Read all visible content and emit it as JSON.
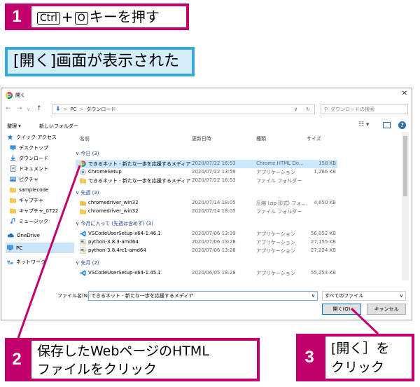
{
  "step1": {
    "num": "1",
    "key_ctrl": "Ctrl",
    "plus": "+",
    "key_o": "O",
    "text": "キーを押す"
  },
  "banner": "[開く]画面が表示された",
  "dialog": {
    "title": "開く",
    "path_root": "PC",
    "path_sep": ">",
    "path_current": "ダウンロード",
    "search_placeholder": "ダウンロードの検索",
    "toolbar": {
      "organize": "整理 ▾",
      "new_folder": "新しいフォルダー"
    },
    "nav": [
      {
        "label": "クイック アクセス",
        "icon": "star-icon"
      },
      {
        "label": "デスクトップ",
        "icon": "desktop-icon"
      },
      {
        "label": "ダウンロード",
        "icon": "download-icon"
      },
      {
        "label": "ドキュメント",
        "icon": "document-icon"
      },
      {
        "label": "ピクチャ",
        "icon": "picture-icon"
      },
      {
        "label": "samplecode",
        "icon": "folder-icon"
      },
      {
        "label": "キャプチャ",
        "icon": "folder-icon"
      },
      {
        "label": "キャプチャ_0722",
        "icon": "folder-icon"
      },
      {
        "label": "ミュージック",
        "icon": "music-icon"
      },
      {
        "label": "OneDrive",
        "icon": "cloud-icon"
      },
      {
        "label": "PC",
        "icon": "pc-icon"
      },
      {
        "label": "ネットワーク",
        "icon": "network-icon"
      }
    ],
    "columns": {
      "name": "名前",
      "date": "更新日時",
      "type": "種類",
      "size": "サイズ"
    },
    "groups": [
      {
        "label": "今日 (3)",
        "files": [
          {
            "name": "できるネット - 新たな一歩を応援するメディア",
            "date": "2020/07/22 16:53",
            "type": "Chrome HTML Do...",
            "size": "158 KB",
            "icon": "chrome-html-icon",
            "selected": true
          },
          {
            "name": "ChromeSetup",
            "date": "2020/07/22 13:59",
            "type": "アプリケーション",
            "size": "1,266 KB",
            "icon": "setup-icon"
          },
          {
            "name": "できるネット - 新たな一歩を応援するメディア_fil...",
            "date": "2020/07/22 16:53",
            "type": "ファイル フォルダー",
            "size": "",
            "icon": "folder-icon"
          }
        ]
      },
      {
        "label": "先週 (2)",
        "files": [
          {
            "name": "chromedriver_win32",
            "date": "2020/07/14 18:05",
            "type": "圧縮 (zip 形式) フォ...",
            "size": "4,650 KB",
            "icon": "zip-icon"
          },
          {
            "name": "chromedriver_win32",
            "date": "2020/07/14 18:05",
            "type": "ファイル フォルダー",
            "size": "",
            "icon": "folder-icon"
          }
        ]
      },
      {
        "label": "今月に入って (先週は含めず) (3)",
        "files": [
          {
            "name": "VSCodeUserSetup-x64-1.46.1",
            "date": "2020/07/06 13:39",
            "type": "アプリケーション",
            "size": "56,052 KB",
            "icon": "vscode-icon"
          },
          {
            "name": "python-3.8.3-amd64",
            "date": "2020/07/06 13:28",
            "type": "アプリケーション",
            "size": "27,155 KB",
            "icon": "python-icon"
          },
          {
            "name": "python-3.8.4rc1-amd64",
            "date": "2020/07/06 13:28",
            "type": "アプリケーション",
            "size": "27,224 KB",
            "icon": "python-icon"
          }
        ]
      },
      {
        "label": "先月 (2)",
        "files": [
          {
            "name": "VSCodeUserSetup-x64-1.45.1",
            "date": "2020/06/05 18:28",
            "type": "アプリケーション",
            "size": "55,254 KB",
            "icon": "vscode-icon"
          }
        ]
      }
    ],
    "filename_label": "ファイル名(N):",
    "filename_value": "できるネット - 新たな一歩を応援するメディア",
    "filter_value": "すべてのファイル",
    "open_button": "開く(O)",
    "cancel_button": "キャンセル"
  },
  "step2": {
    "num": "2",
    "line1": "保存したWebページのHTML",
    "line2": "ファイルをクリック"
  },
  "step3": {
    "num": "3",
    "line1": "[開く］を",
    "line2": "クリック"
  },
  "colors": {
    "accent": "#c2006b",
    "banner_border": "#35a9e0",
    "banner_bg": "#d5edf9"
  }
}
